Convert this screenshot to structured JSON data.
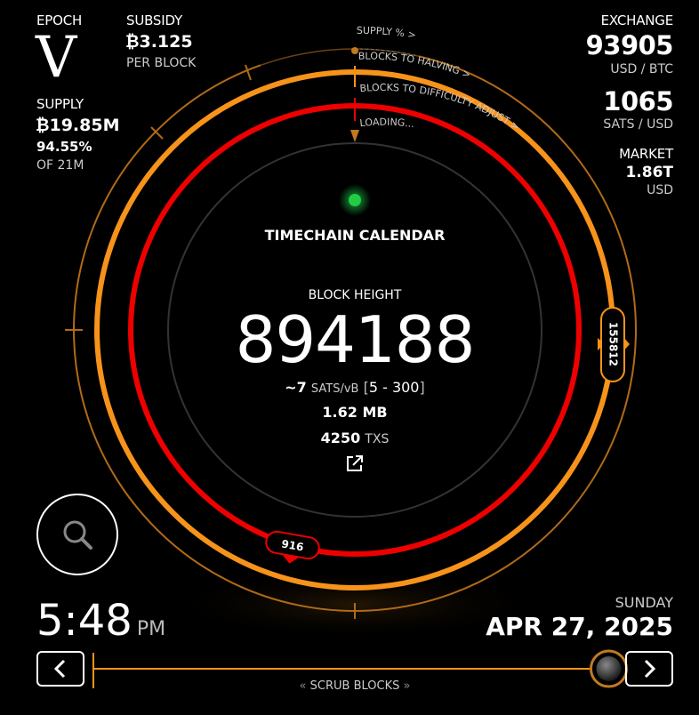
{
  "epoch": {
    "label": "EPOCH",
    "numeral": "V"
  },
  "subsidy": {
    "label": "SUBSIDY",
    "value": "₿3.125",
    "unit": "PER BLOCK"
  },
  "supply": {
    "label": "SUPPLY",
    "value": "₿19.85M",
    "percent": "94.55%",
    "of_total": "OF 21M"
  },
  "exchange": {
    "label": "EXCHANGE",
    "price": "93905",
    "price_unit": "USD / BTC",
    "sats": "1065",
    "sats_unit": "SATS / USD"
  },
  "market": {
    "label": "MARKET",
    "value": "1.86T",
    "unit": "USD"
  },
  "rings": {
    "supply_label": "SUPPLY % >",
    "halving_label": "BLOCKS TO HALVING >",
    "difficulty_label": "BLOCKS TO DIFFICULTY ADJUST >",
    "loading_label": "LOADING...",
    "halving_blocks": "155812",
    "difficulty_blocks": "916",
    "supply_percent": 94.55
  },
  "center": {
    "title": "TIMECHAIN CALENDAR",
    "block_height_label": "BLOCK HEIGHT",
    "block_height": "894188",
    "fee_approx": "~7",
    "fee_unit": "SATS/vB",
    "fee_range_open": "[",
    "fee_range": "5 - 300",
    "fee_range_close": "]",
    "size": "1.62 MB",
    "tx_count": "4250",
    "tx_unit": "TXS"
  },
  "clock": {
    "time": "5:48",
    "ampm": "PM"
  },
  "date": {
    "weekday": "SUNDAY",
    "date": "APR 27, 2025"
  },
  "scrub": {
    "label": "SCRUB BLOCKS",
    "position": 0.95
  },
  "colors": {
    "orange": "#f7931a",
    "red": "#ee0000",
    "green": "#22cc44",
    "dim_ring": "#8a5515"
  }
}
